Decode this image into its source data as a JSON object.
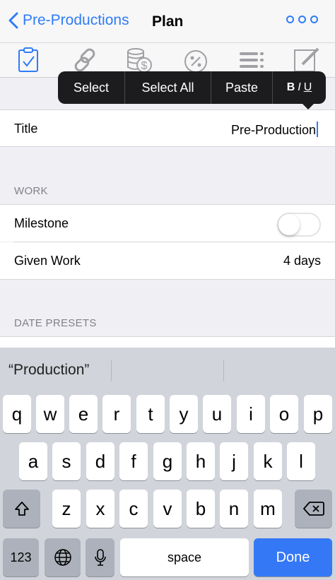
{
  "nav": {
    "back_label": "Pre-Productions",
    "title": "Plan"
  },
  "toolbar": {
    "icons": [
      "checklist-icon",
      "link-icon",
      "money-icon",
      "percent-icon",
      "list-icon",
      "edit-icon"
    ]
  },
  "edit_menu": {
    "select": "Select",
    "select_all": "Select All",
    "paste": "Paste",
    "bold": "B",
    "italic": "I",
    "underline": "U"
  },
  "form": {
    "title_label": "Title",
    "title_value": "Pre-Production",
    "work_header": "WORK",
    "milestone_label": "Milestone",
    "milestone_on": false,
    "given_work_label": "Given Work",
    "given_work_value": "4 days",
    "date_presets_header": "DATE PRESETS"
  },
  "keyboard": {
    "suggestion": "“Production”",
    "row1": [
      "q",
      "w",
      "e",
      "r",
      "t",
      "y",
      "u",
      "i",
      "o",
      "p"
    ],
    "row2": [
      "a",
      "s",
      "d",
      "f",
      "g",
      "h",
      "j",
      "k",
      "l"
    ],
    "row3": [
      "z",
      "x",
      "c",
      "v",
      "b",
      "n",
      "m"
    ],
    "numbers_key": "123",
    "space_key": "space",
    "done_key": "Done"
  },
  "colors": {
    "accent": "#2f7cf6",
    "done": "#3478f6"
  }
}
